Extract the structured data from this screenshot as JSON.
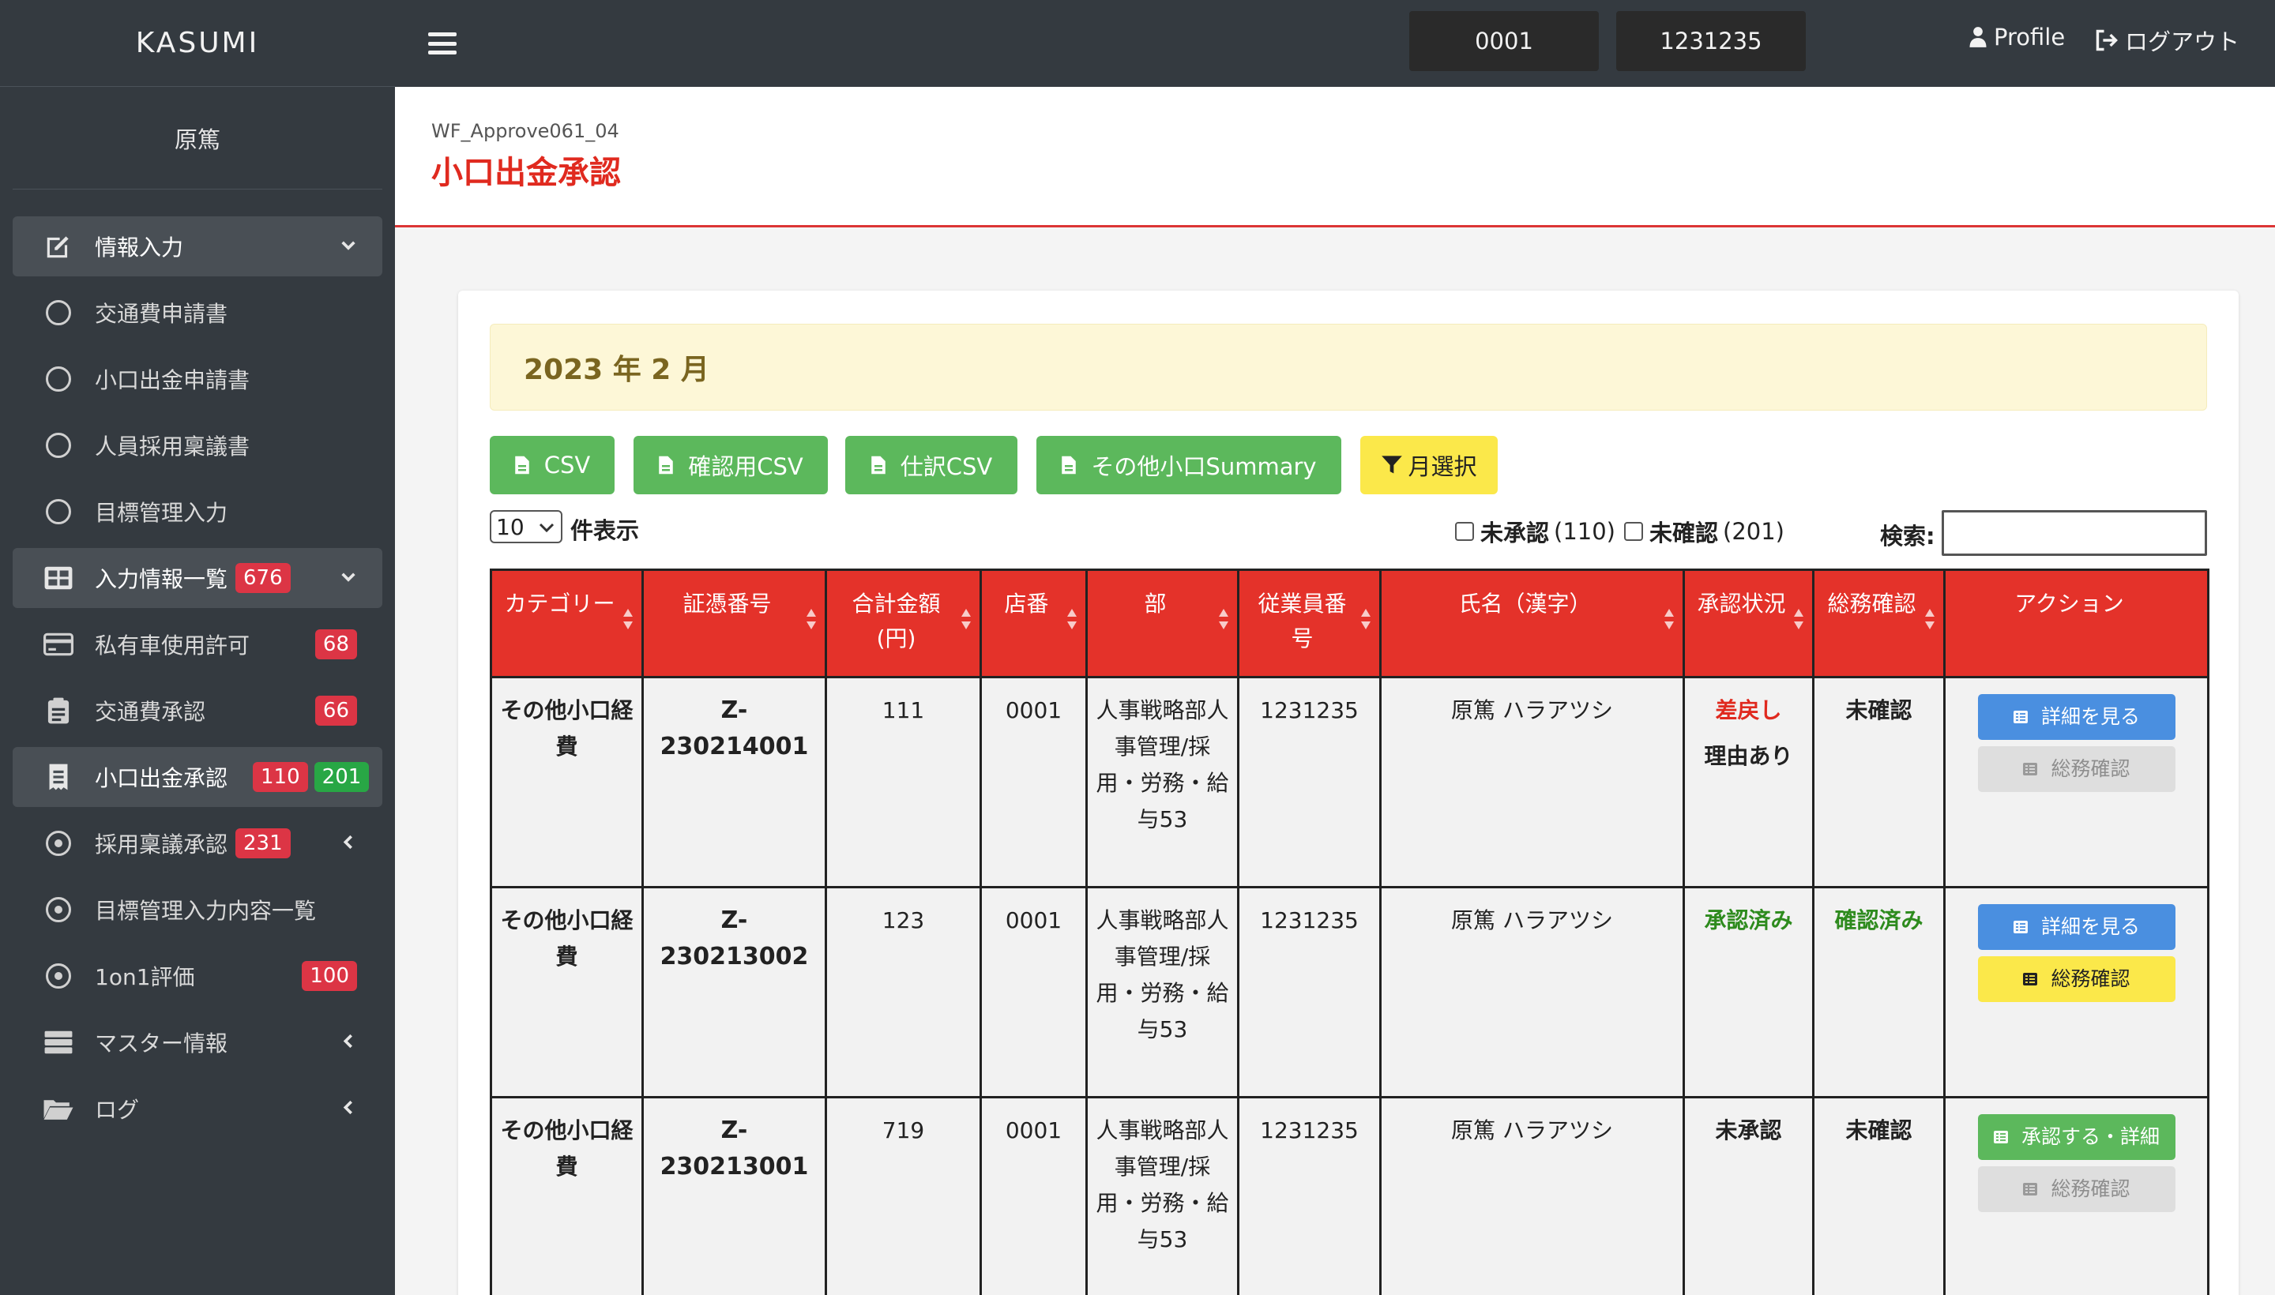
{
  "brand": "KASUMI",
  "user": {
    "name": "原篤"
  },
  "topbar": {
    "store_code": "0001",
    "employee_code": "1231235",
    "profile_label": "Profile",
    "logout_label": "ログアウト"
  },
  "sidebar": {
    "items": [
      {
        "label": "情報入力",
        "icon": "edit-icon"
      },
      {
        "label": "交通費申請書",
        "icon": "circle-icon"
      },
      {
        "label": "小口出金申請書",
        "icon": "circle-icon"
      },
      {
        "label": "人員採用稟議書",
        "icon": "circle-icon"
      },
      {
        "label": "目標管理入力",
        "icon": "circle-icon"
      },
      {
        "label": "入力情報一覧",
        "icon": "table-icon",
        "badge": "676"
      },
      {
        "label": "私有車使用許可",
        "icon": "card-icon",
        "badge": "68"
      },
      {
        "label": "交通費承認",
        "icon": "clipboard-icon",
        "badge": "66"
      },
      {
        "label": "小口出金承認",
        "icon": "receipt-icon",
        "badge": "110",
        "badge2": "201"
      },
      {
        "label": "採用稟議承認",
        "icon": "dot-circle-icon",
        "badge": "231"
      },
      {
        "label": "目標管理入力内容一覧",
        "icon": "dot-circle-icon"
      },
      {
        "label": "1on1評価",
        "icon": "dot-circle-icon",
        "badge": "100"
      },
      {
        "label": "マスター情報",
        "icon": "server-icon"
      },
      {
        "label": "ログ",
        "icon": "folder-icon"
      }
    ]
  },
  "header": {
    "screen_id": "WF_Approve061_04",
    "title": "小口出金承認"
  },
  "main": {
    "month_label": "2023 年 2 月",
    "buttons": {
      "csv": "CSV",
      "confirm_csv": "確認用CSV",
      "journal_csv": "仕訳CSV",
      "other_summary": "その他小口Summary",
      "month_select": "月選択"
    },
    "page_length": "10",
    "page_length_suffix": "件表示",
    "filter_unapproved": "未承認",
    "filter_unapproved_count": "(110)",
    "filter_unconfirmed": "未確認",
    "filter_unconfirmed_count": "(201)",
    "search_label": "検索:",
    "columns": [
      "カテゴリー",
      "証憑番号",
      "合計金額(円)",
      "店番",
      "部",
      "従業員番号",
      "氏名（漢字）",
      "承認状況",
      "総務確認",
      "アクション"
    ],
    "rows": [
      {
        "category": "その他小口経費",
        "voucher": "Z-230214001",
        "amount": "111",
        "store": "0001",
        "dept": "人事戦略部人事管理/採用・労務・給与53",
        "employee": "1231235",
        "name": "原篤 ハラアツシ",
        "status": "差戻し",
        "status_note": "理由あり",
        "confirm": "未確認",
        "actions": [
          "詳細を見る",
          "総務確認"
        ]
      },
      {
        "category": "その他小口経費",
        "voucher": "Z-230213002",
        "amount": "123",
        "store": "0001",
        "dept": "人事戦略部人事管理/採用・労務・給与53",
        "employee": "1231235",
        "name": "原篤 ハラアツシ",
        "status": "承認済み",
        "status_note": "",
        "confirm": "確認済み",
        "actions": [
          "詳細を見る",
          "総務確認"
        ]
      },
      {
        "category": "その他小口経費",
        "voucher": "Z-230213001",
        "amount": "719",
        "store": "0001",
        "dept": "人事戦略部人事管理/採用・労務・給与53",
        "employee": "1231235",
        "name": "原篤 ハラアツシ",
        "status": "未承認",
        "status_note": "",
        "confirm": "未確認",
        "actions": [
          "承認する・詳細",
          "総務確認"
        ]
      }
    ]
  },
  "colors": {
    "sidebar_bg": "#343a40",
    "header_red": "#e4322a",
    "title_red": "#e02a1f",
    "button_green": "#5cb85c",
    "button_yellow": "#fbe84a",
    "button_blue": "#4a8fe0"
  }
}
